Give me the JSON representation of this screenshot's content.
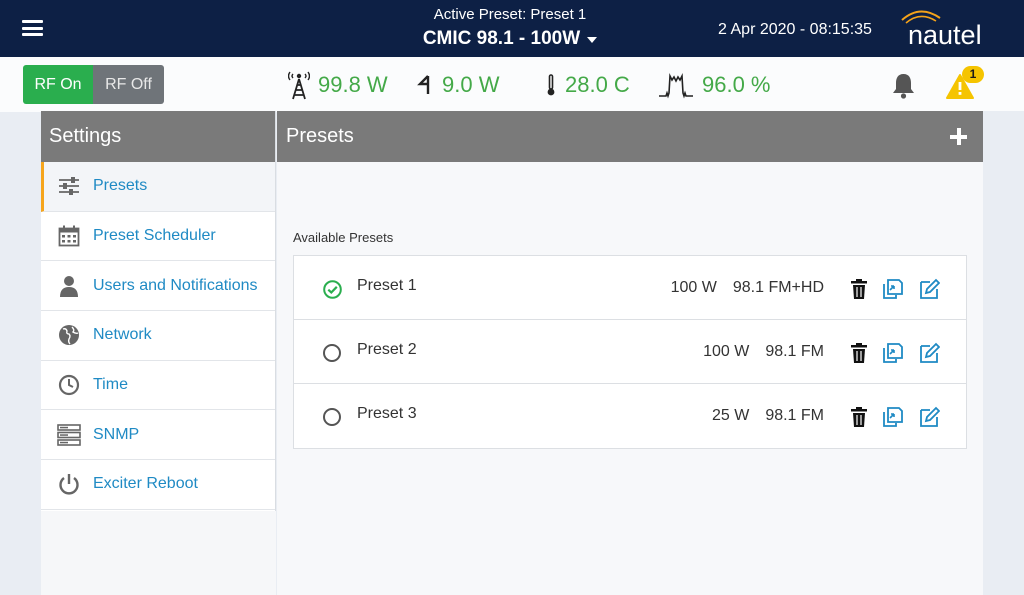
{
  "header": {
    "active_preset_label": "Active Preset: Preset 1",
    "station": "CMIC 98.1 - 100W",
    "datetime": "2 Apr 2020 - 08:15:35",
    "logo_text": "nautel"
  },
  "status": {
    "rf_on_label": "RF On",
    "rf_off_label": "RF Off",
    "forward_power": "99.8 W",
    "reflected_power": "9.0 W",
    "temperature": "28.0 C",
    "efficiency": "96.0 %",
    "alarm_count": "1",
    "accent_green": "#44a948"
  },
  "sidebar": {
    "title": "Settings",
    "items": [
      {
        "label": "Presets",
        "icon": "sliders-icon",
        "active": true
      },
      {
        "label": "Preset Scheduler",
        "icon": "calendar-icon"
      },
      {
        "label": "Users and Notifications",
        "icon": "user-icon"
      },
      {
        "label": "Network",
        "icon": "globe-icon"
      },
      {
        "label": "Time",
        "icon": "clock-icon"
      },
      {
        "label": "SNMP",
        "icon": "server-icon"
      },
      {
        "label": "Exciter Reboot",
        "icon": "power-icon"
      }
    ]
  },
  "main": {
    "title": "Presets",
    "available_label": "Available Presets",
    "presets": [
      {
        "name": "Preset 1",
        "power": "100 W",
        "mode": "98.1 FM+HD",
        "active": true
      },
      {
        "name": "Preset 2",
        "power": "100 W",
        "mode": "98.1 FM",
        "active": false
      },
      {
        "name": "Preset 3",
        "power": "25 W",
        "mode": "98.1 FM",
        "active": false
      }
    ]
  }
}
